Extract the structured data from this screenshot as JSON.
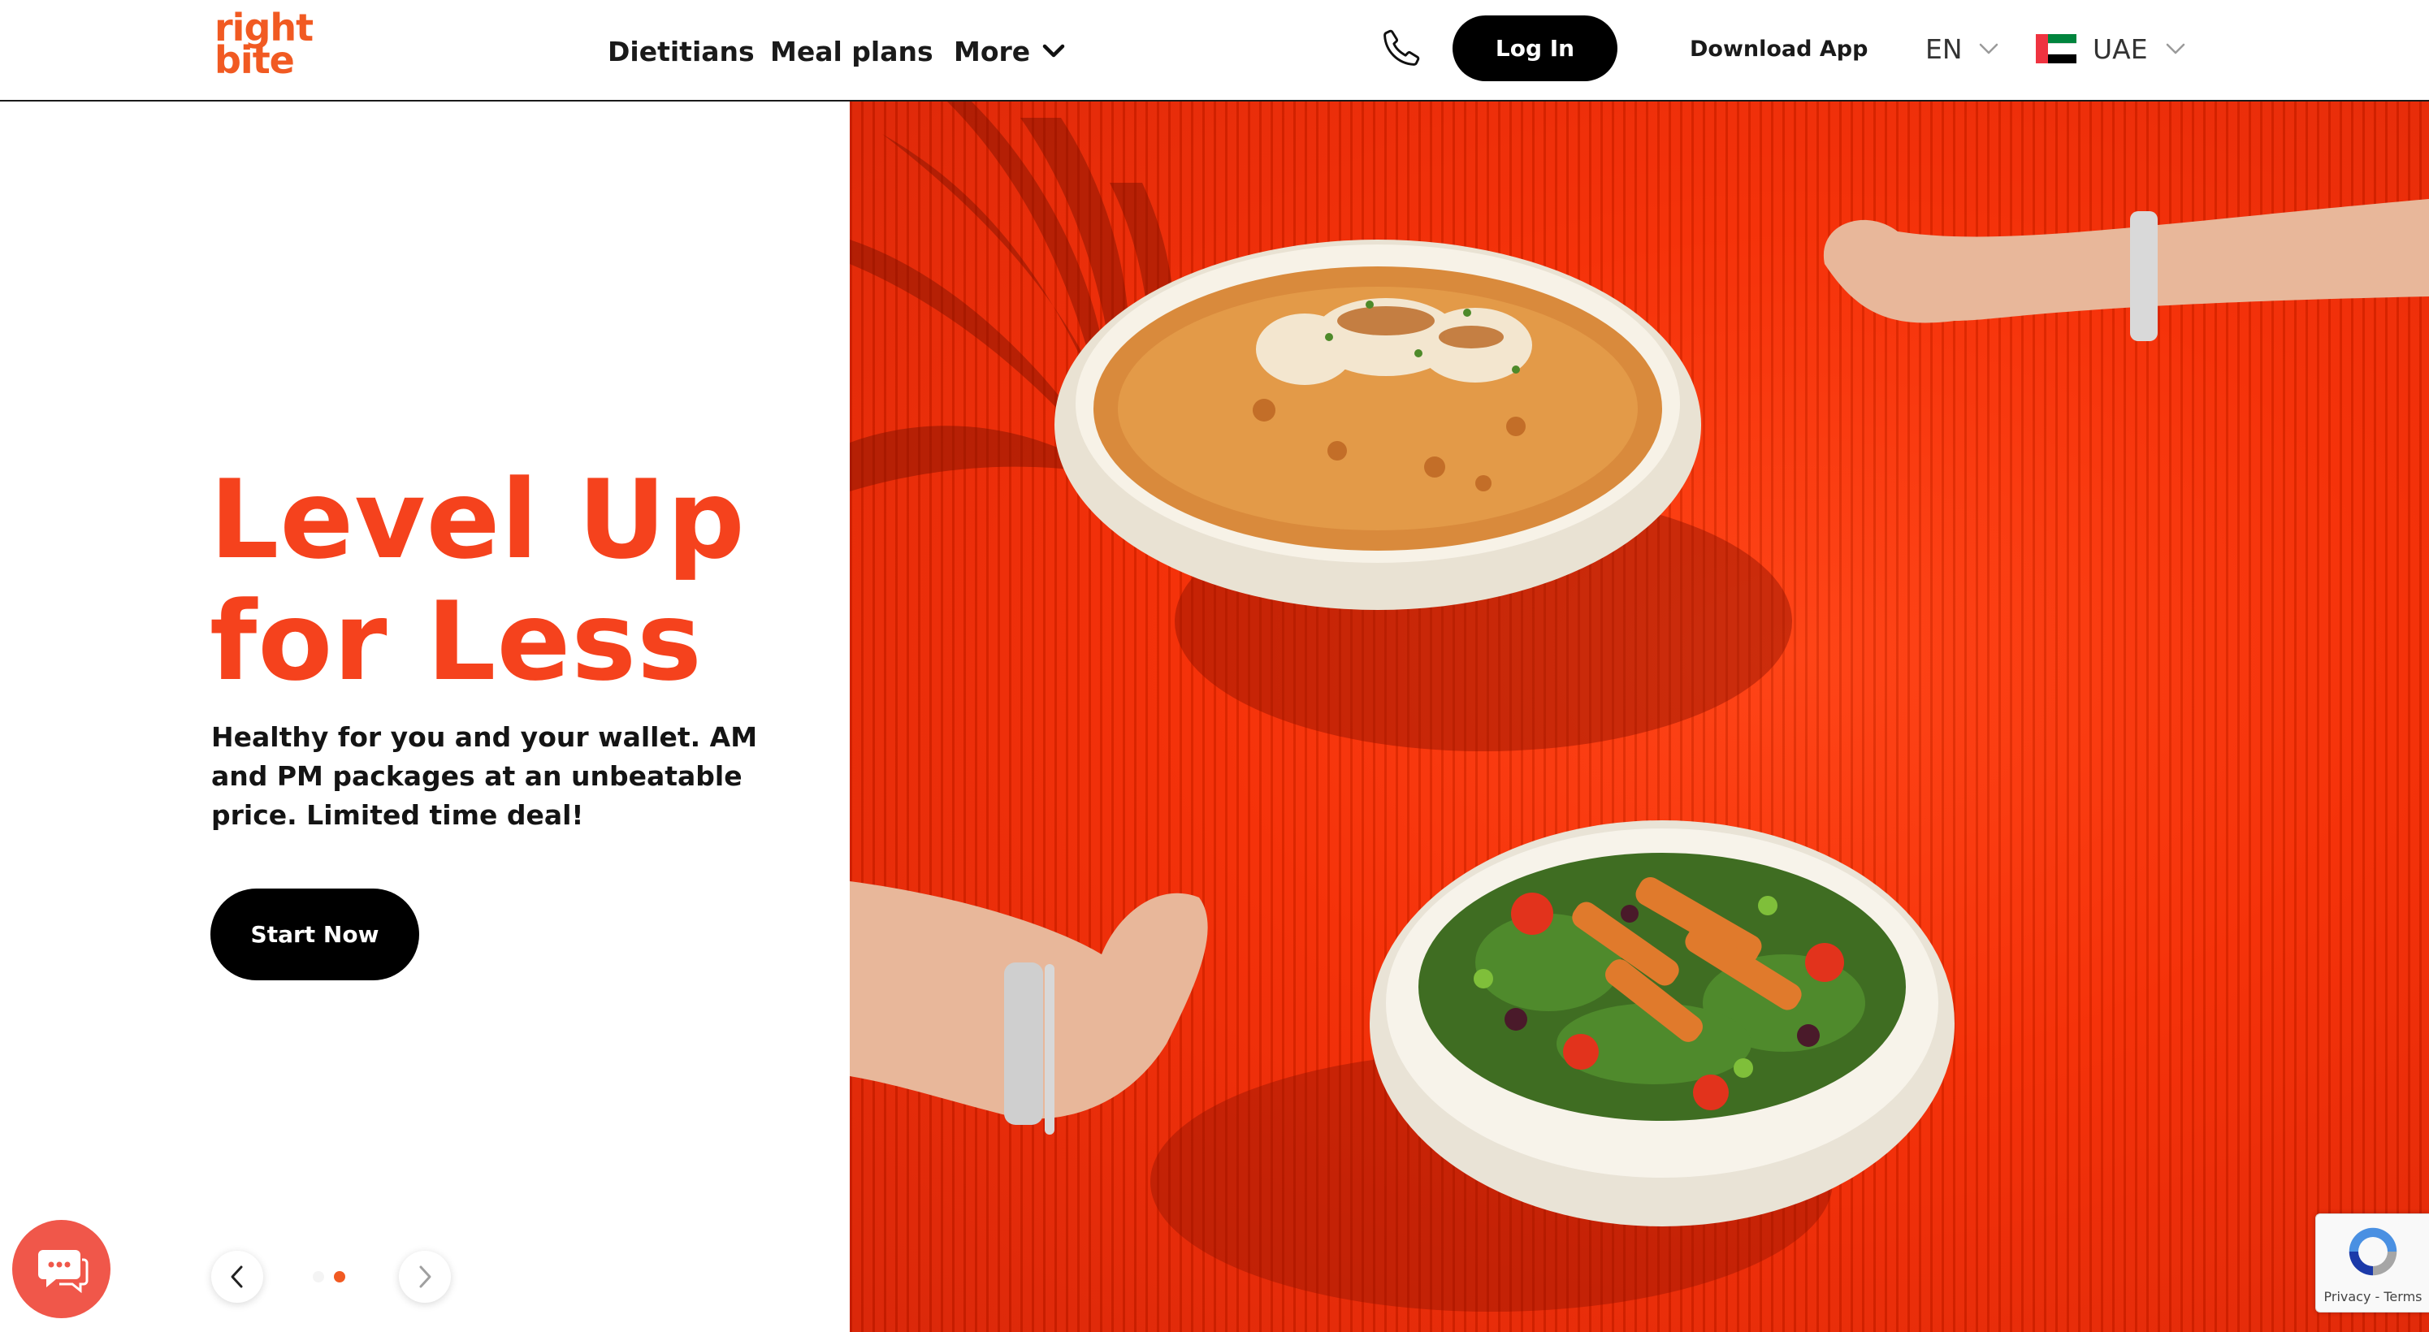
{
  "header": {
    "logo_line1": "right",
    "logo_line2": "bite",
    "nav": {
      "dietitians": "Dietitians",
      "meal_plans": "Meal plans",
      "more": "More"
    },
    "login_label": "Log In",
    "download_label": "Download App",
    "language": "EN",
    "country": "UAE"
  },
  "hero": {
    "headline_line1": "Level Up",
    "headline_line2": "for Less",
    "subcopy": "Healthy for you and your wallet. AM and PM packages at an unbeatable price. Limited time deal!",
    "cta_label": "Start Now",
    "slides_total": 2,
    "slide_active": 2
  },
  "recaptcha": {
    "links": "Privacy - Terms"
  },
  "icons": {
    "phone": "phone-icon",
    "more_chevron": "chevron-down-icon",
    "lang_chevron": "chevron-down-icon",
    "country_flag": "uae-flag-icon",
    "prev": "chevron-left-icon",
    "next": "chevron-right-icon",
    "chat": "chat-icon",
    "recaptcha": "recaptcha-icon"
  },
  "colors": {
    "brand_orange": "#f15a22",
    "headline_orange": "#f5421d",
    "hero_red": "#f52a00",
    "button_black": "#000000",
    "chat_coral": "#f0574a"
  }
}
